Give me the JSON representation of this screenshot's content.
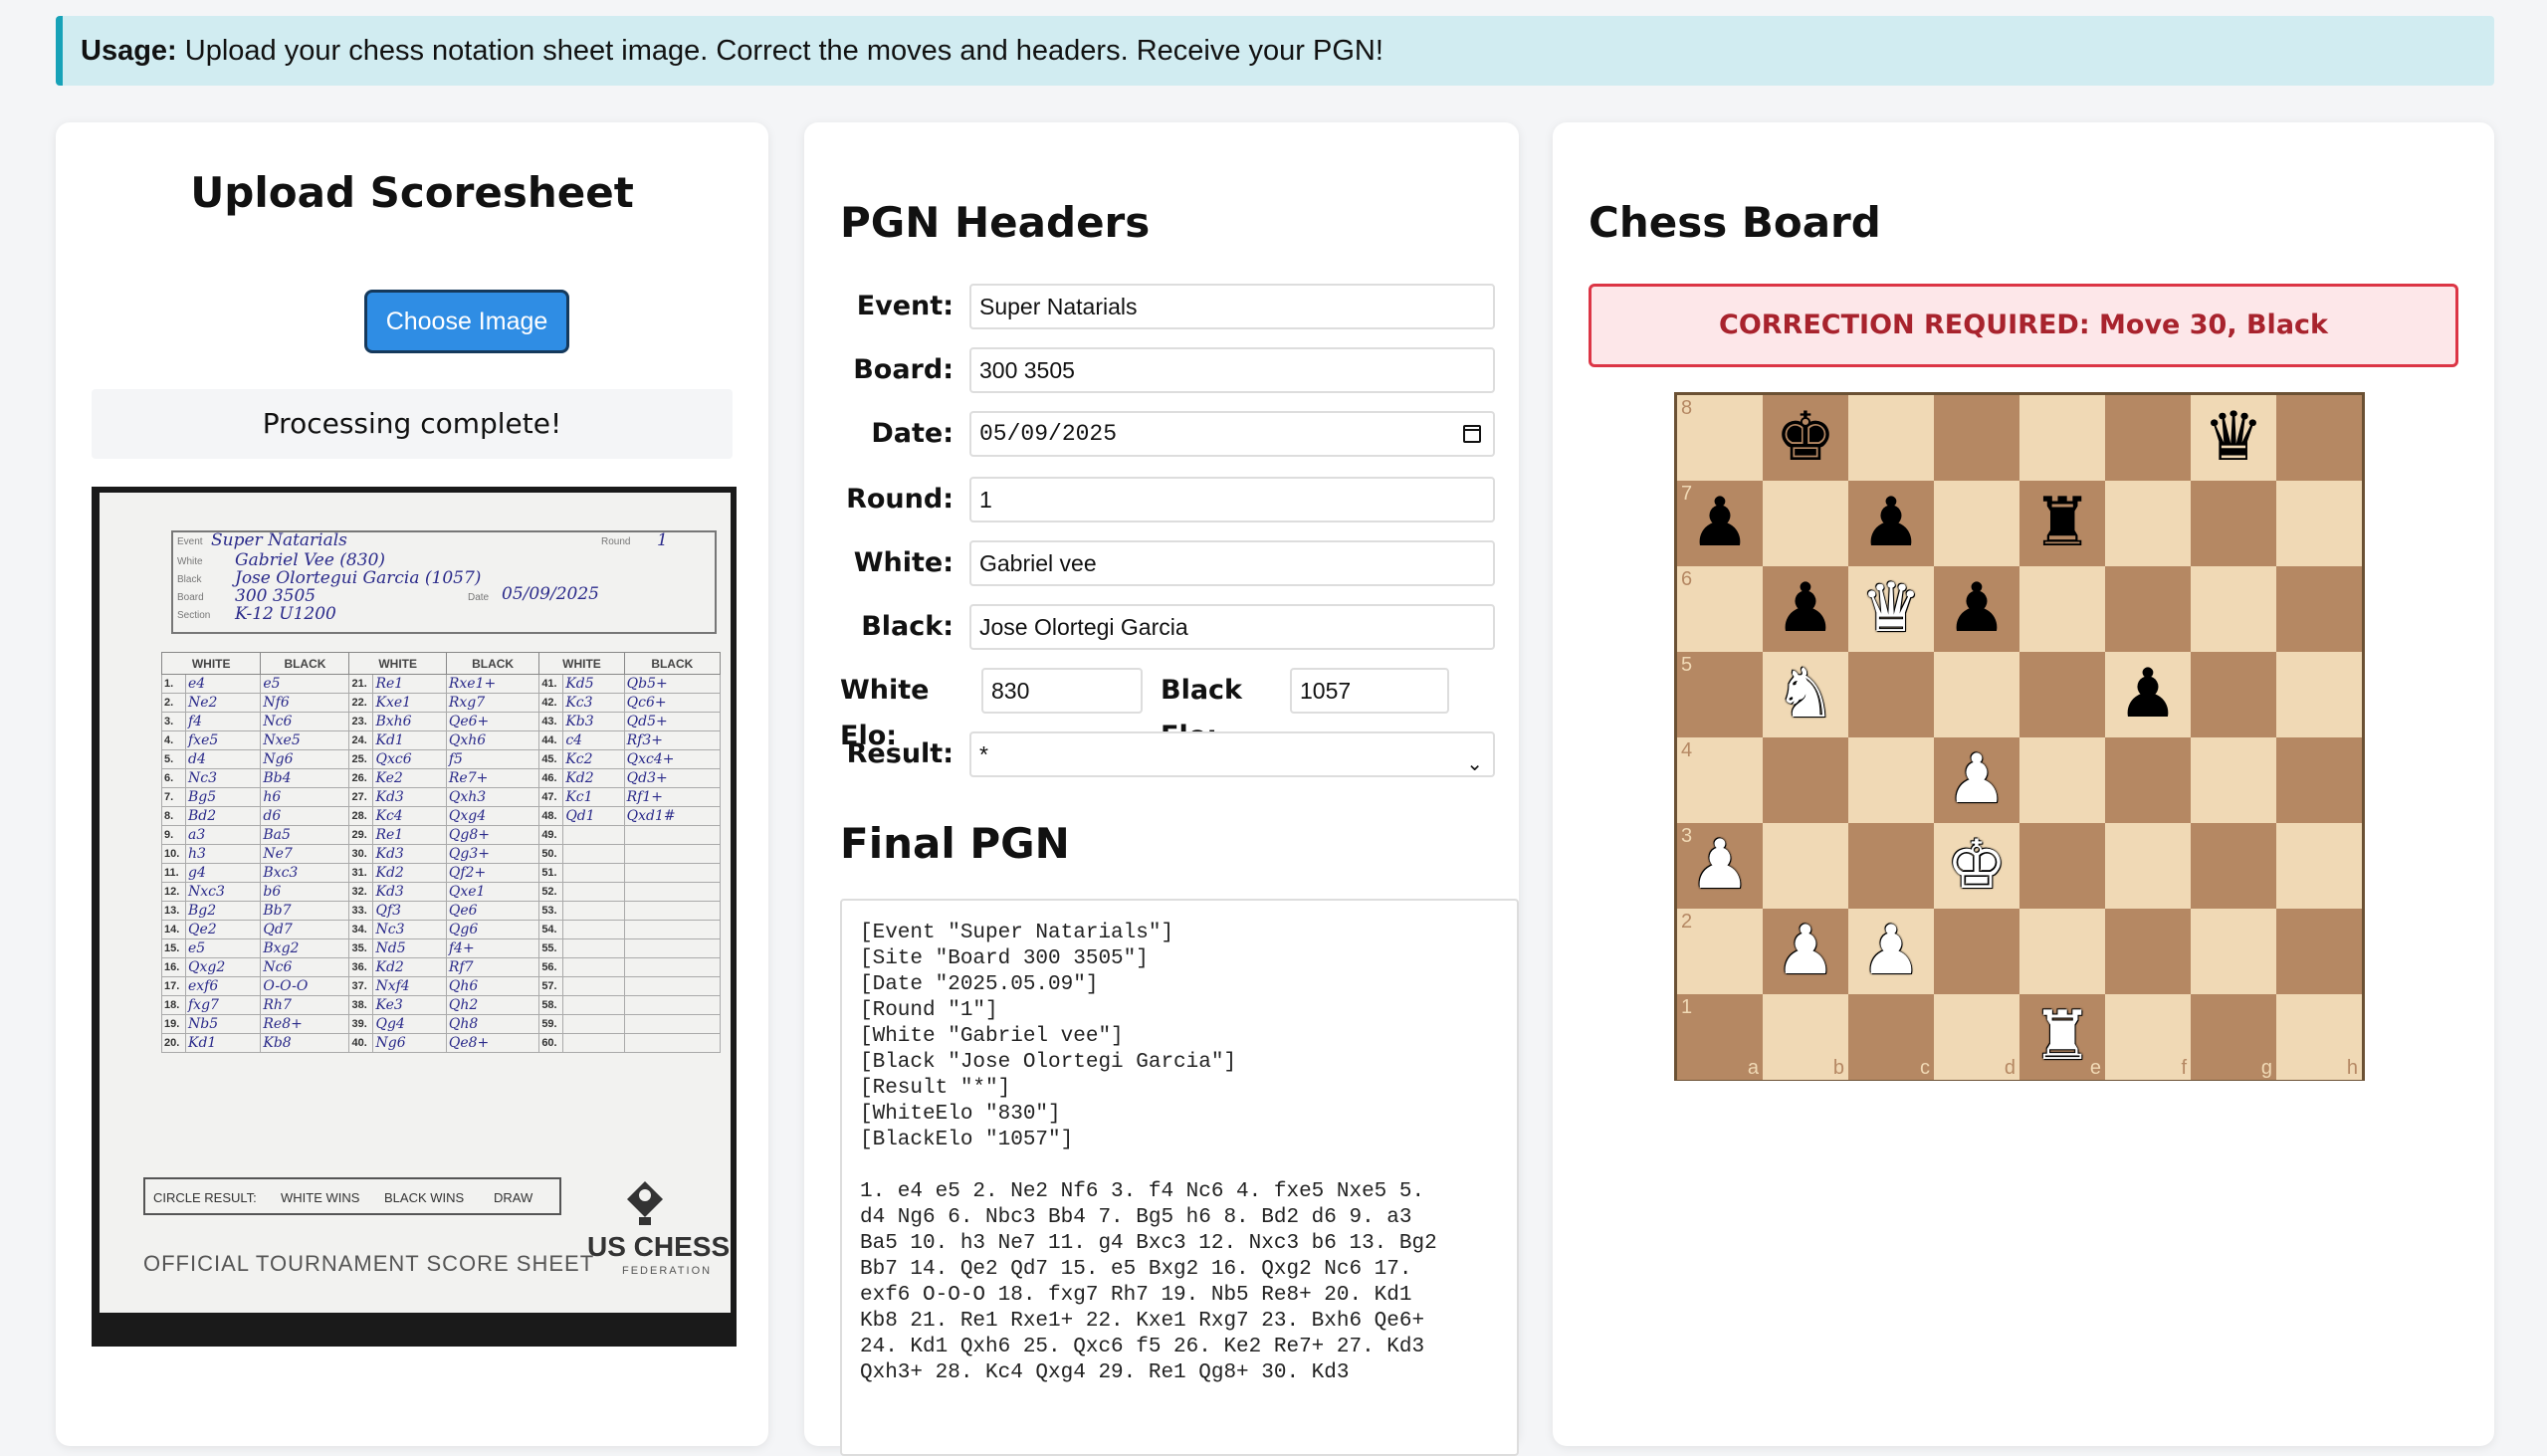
{
  "usage": {
    "label": "Usage:",
    "text": "Upload your chess notation sheet image. Correct the moves and headers. Receive your PGN!"
  },
  "upload": {
    "title": "Upload Scoresheet",
    "button_label": "Choose Image",
    "status": "Processing complete!",
    "sheet": {
      "labels": {
        "event": "Event",
        "white": "White",
        "black": "Black",
        "board": "Board",
        "section": "Section",
        "round": "Round",
        "date": "Date"
      },
      "event": "Super Natarials",
      "white": "Gabriel Vee (830)",
      "black": "Jose Olortegui Garcia (1057)",
      "board": "300 3505",
      "section": "K-12 U1200",
      "round": "1",
      "date": "05/09/2025",
      "columns": [
        "WHITE",
        "BLACK",
        "WHITE",
        "BLACK",
        "WHITE",
        "BLACK"
      ],
      "rows": [
        [
          "1.",
          "e4",
          "e5",
          "21.",
          "Re1",
          "Rxe1+",
          "41.",
          "Kd5",
          "Qb5+"
        ],
        [
          "2.",
          "Ne2",
          "Nf6",
          "22.",
          "Kxe1",
          "Rxg7",
          "42.",
          "Kc3",
          "Qc6+"
        ],
        [
          "3.",
          "f4",
          "Nc6",
          "23.",
          "Bxh6",
          "Qe6+",
          "43.",
          "Kb3",
          "Qd5+"
        ],
        [
          "4.",
          "fxe5",
          "Nxe5",
          "24.",
          "Kd1",
          "Qxh6",
          "44.",
          "c4",
          "Rf3+"
        ],
        [
          "5.",
          "d4",
          "Ng6",
          "25.",
          "Qxc6",
          "f5",
          "45.",
          "Kc2",
          "Qxc4+"
        ],
        [
          "6.",
          "Nc3",
          "Bb4",
          "26.",
          "Ke2",
          "Re7+",
          "46.",
          "Kd2",
          "Qd3+"
        ],
        [
          "7.",
          "Bg5",
          "h6",
          "27.",
          "Kd3",
          "Qxh3",
          "47.",
          "Kc1",
          "Rf1+"
        ],
        [
          "8.",
          "Bd2",
          "d6",
          "28.",
          "Kc4",
          "Qxg4",
          "48.",
          "Qd1",
          "Qxd1#"
        ],
        [
          "9.",
          "a3",
          "Ba5",
          "29.",
          "Re1",
          "Qg8+",
          "49.",
          "",
          ""
        ],
        [
          "10.",
          "h3",
          "Ne7",
          "30.",
          "Kd3",
          "Qg3+",
          "50.",
          "",
          ""
        ],
        [
          "11.",
          "g4",
          "Bxc3",
          "31.",
          "Kd2",
          "Qf2+",
          "51.",
          "",
          ""
        ],
        [
          "12.",
          "Nxc3",
          "b6",
          "32.",
          "Kd3",
          "Qxe1",
          "52.",
          "",
          ""
        ],
        [
          "13.",
          "Bg2",
          "Bb7",
          "33.",
          "Qf3",
          "Qe6",
          "53.",
          "",
          ""
        ],
        [
          "14.",
          "Qe2",
          "Qd7",
          "34.",
          "Nc3",
          "Qg6",
          "54.",
          "",
          ""
        ],
        [
          "15.",
          "e5",
          "Bxg2",
          "35.",
          "Nd5",
          "f4+",
          "55.",
          "",
          ""
        ],
        [
          "16.",
          "Qxg2",
          "Nc6",
          "36.",
          "Kd2",
          "Rf7",
          "56.",
          "",
          ""
        ],
        [
          "17.",
          "exf6",
          "O-O-O",
          "37.",
          "Nxf4",
          "Qh6",
          "57.",
          "",
          ""
        ],
        [
          "18.",
          "fxg7",
          "Rh7",
          "38.",
          "Ke3",
          "Qh2",
          "58.",
          "",
          ""
        ],
        [
          "19.",
          "Nb5",
          "Re8+",
          "39.",
          "Qg4",
          "Qh8",
          "59.",
          "",
          ""
        ],
        [
          "20.",
          "Kd1",
          "Kb8",
          "40.",
          "Ng6",
          "Qe8+",
          "60.",
          "",
          ""
        ]
      ],
      "circle_result": "CIRCLE RESULT:",
      "white_wins": "WHITE WINS",
      "black_wins": "BLACK WINS",
      "draw": "DRAW",
      "official": "OFFICIAL TOURNAMENT SCORE SHEET",
      "brand": "US CHESS",
      "federation": "FEDERATION"
    }
  },
  "headers": {
    "title": "PGN Headers",
    "event_label": "Event:",
    "event": "Super Natarials",
    "board_label": "Board:",
    "board": "300 3505",
    "date_label": "Date:",
    "date": "05/09/2025",
    "round_label": "Round:",
    "round": "1",
    "white_label": "White:",
    "white": "Gabriel vee",
    "black_label": "Black:",
    "black": "Jose Olortegi Garcia",
    "white_elo_label": "White Elo:",
    "white_elo": "830",
    "black_elo_label": "Black Elo:",
    "black_elo": "1057",
    "result_label": "Result:",
    "result": "*",
    "pgn_title": "Final PGN",
    "pgn": "[Event \"Super Natarials\"]\n[Site \"Board 300 3505\"]\n[Date \"2025.05.09\"]\n[Round \"1\"]\n[White \"Gabriel vee\"]\n[Black \"Jose Olortegi Garcia\"]\n[Result \"*\"]\n[WhiteElo \"830\"]\n[BlackElo \"1057\"]\n\n1. e4 e5 2. Ne2 Nf6 3. f4 Nc6 4. fxe5 Nxe5 5.\nd4 Ng6 6. Nbc3 Bb4 7. Bg5 h6 8. Bd2 d6 9. a3\nBa5 10. h3 Ne7 11. g4 Bxc3 12. Nxc3 b6 13. Bg2\nBb7 14. Qe2 Qd7 15. e5 Bxg2 16. Qxg2 Nc6 17.\nexf6 O-O-O 18. fxg7 Rh7 19. Nb5 Re8+ 20. Kd1\nKb8 21. Re1 Rxe1+ 22. Kxe1 Rxg7 23. Bxh6 Qe6+\n24. Kd1 Qxh6 25. Qxc6 f5 26. Ke2 Re7+ 27. Kd3\nQxh3+ 28. Kc4 Qxg4 29. Re1 Qg8+ 30. Kd3"
  },
  "board": {
    "title": "Chess Board",
    "alert": "CORRECTION REQUIRED: Move 30, Black",
    "files": [
      "a",
      "b",
      "c",
      "d",
      "e",
      "f",
      "g",
      "h"
    ],
    "ranks": [
      "8",
      "7",
      "6",
      "5",
      "4",
      "3",
      "2",
      "1"
    ],
    "pieces": {
      "b8": "bk",
      "g8": "bq",
      "a7": "bp",
      "c7": "bp",
      "e7": "br",
      "b6": "bp",
      "c6": "wq",
      "d6": "bp",
      "b5": "wn",
      "f5": "bp",
      "d4": "wp",
      "a3": "wp",
      "d3": "wk",
      "b2": "wp",
      "c2": "wp",
      "e1": "wr"
    }
  }
}
